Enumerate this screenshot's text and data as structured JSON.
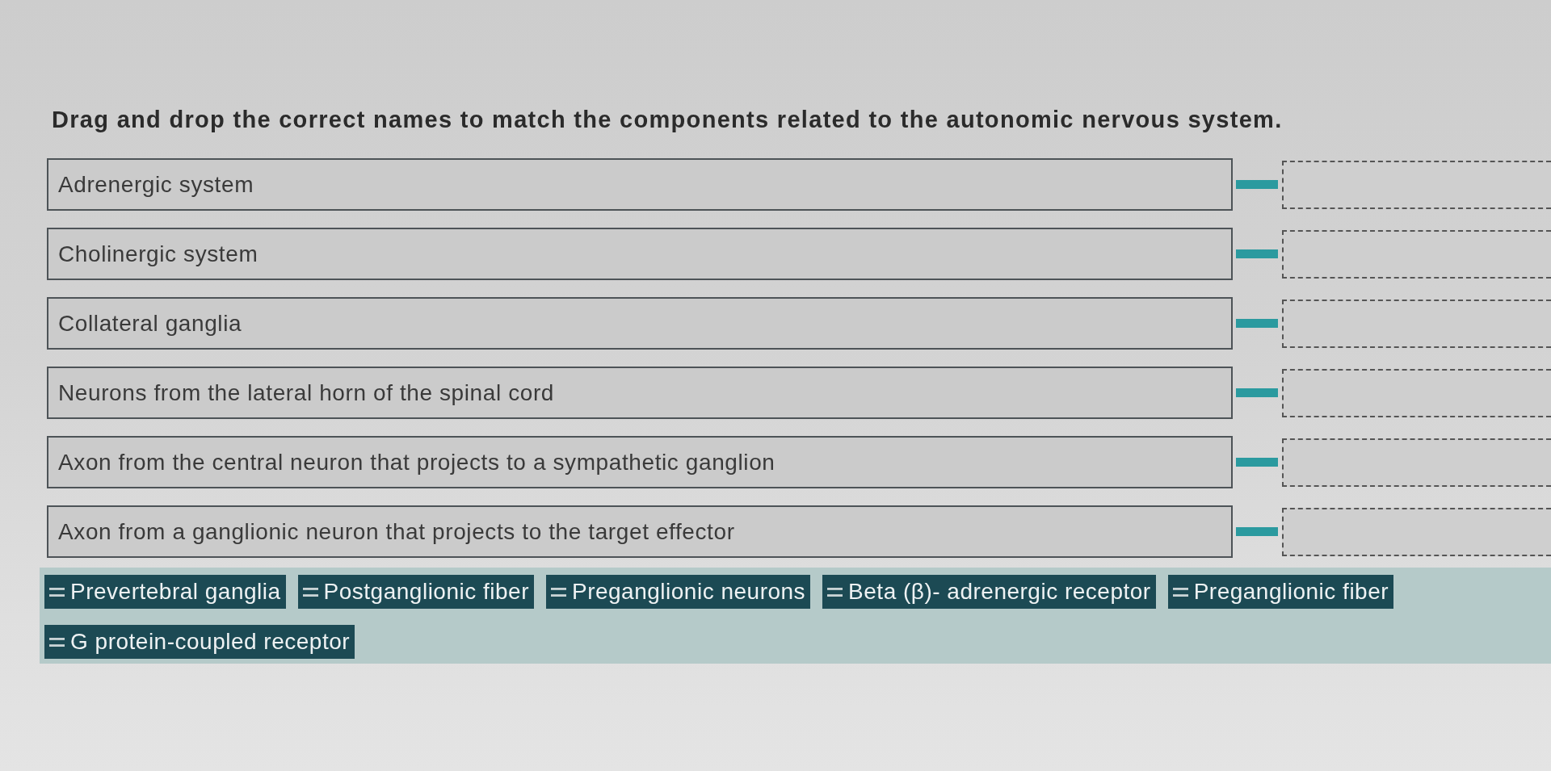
{
  "instruction": "Drag and drop the correct names to match the components related to the autonomic nervous system.",
  "items": [
    {
      "label": "Adrenergic system"
    },
    {
      "label": "Cholinergic system"
    },
    {
      "label": "Collateral ganglia"
    },
    {
      "label": "Neurons from the lateral horn of the spinal cord"
    },
    {
      "label": "Axon from the central neuron that projects to a sympathetic ganglion"
    },
    {
      "label": "Axon from a ganglionic neuron that projects to the target effector"
    }
  ],
  "answer_bank": [
    {
      "label": "Prevertebral ganglia"
    },
    {
      "label": "Postganglionic fiber"
    },
    {
      "label": "Preganglionic neurons"
    },
    {
      "label": "Beta (β)- adrenergic receptor"
    },
    {
      "label": "Preganglionic fiber"
    },
    {
      "label": "G protein-coupled receptor"
    }
  ]
}
